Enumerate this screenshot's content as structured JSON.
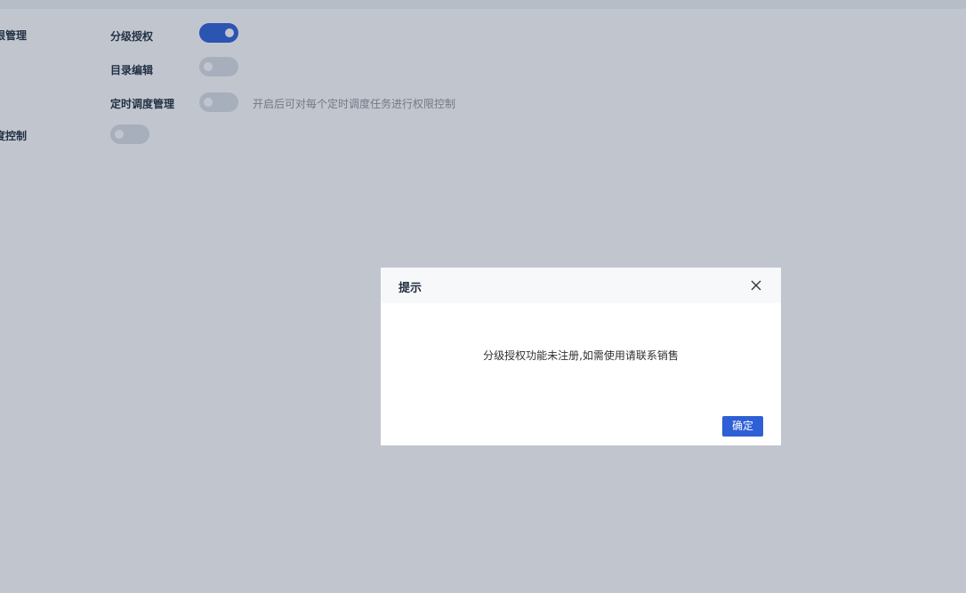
{
  "settings": {
    "section1_label": "限管理",
    "section2_label": "度控制",
    "items": [
      {
        "label": "分级授权",
        "enabled": true
      },
      {
        "label": "目录编辑",
        "enabled": false
      },
      {
        "label": "定时调度管理",
        "enabled": false,
        "hint": "开启后可对每个定时调度任务进行权限控制"
      }
    ],
    "section2_enabled": false
  },
  "dialog": {
    "title": "提示",
    "message": "分级授权功能未注册,如需使用请联系销售",
    "ok_label": "确定",
    "close_icon": "close-icon"
  },
  "colors": {
    "accent": "#2e5fd6",
    "switch_off": "#dcdfe6",
    "overlay": "rgba(40,58,86,0.29)"
  }
}
